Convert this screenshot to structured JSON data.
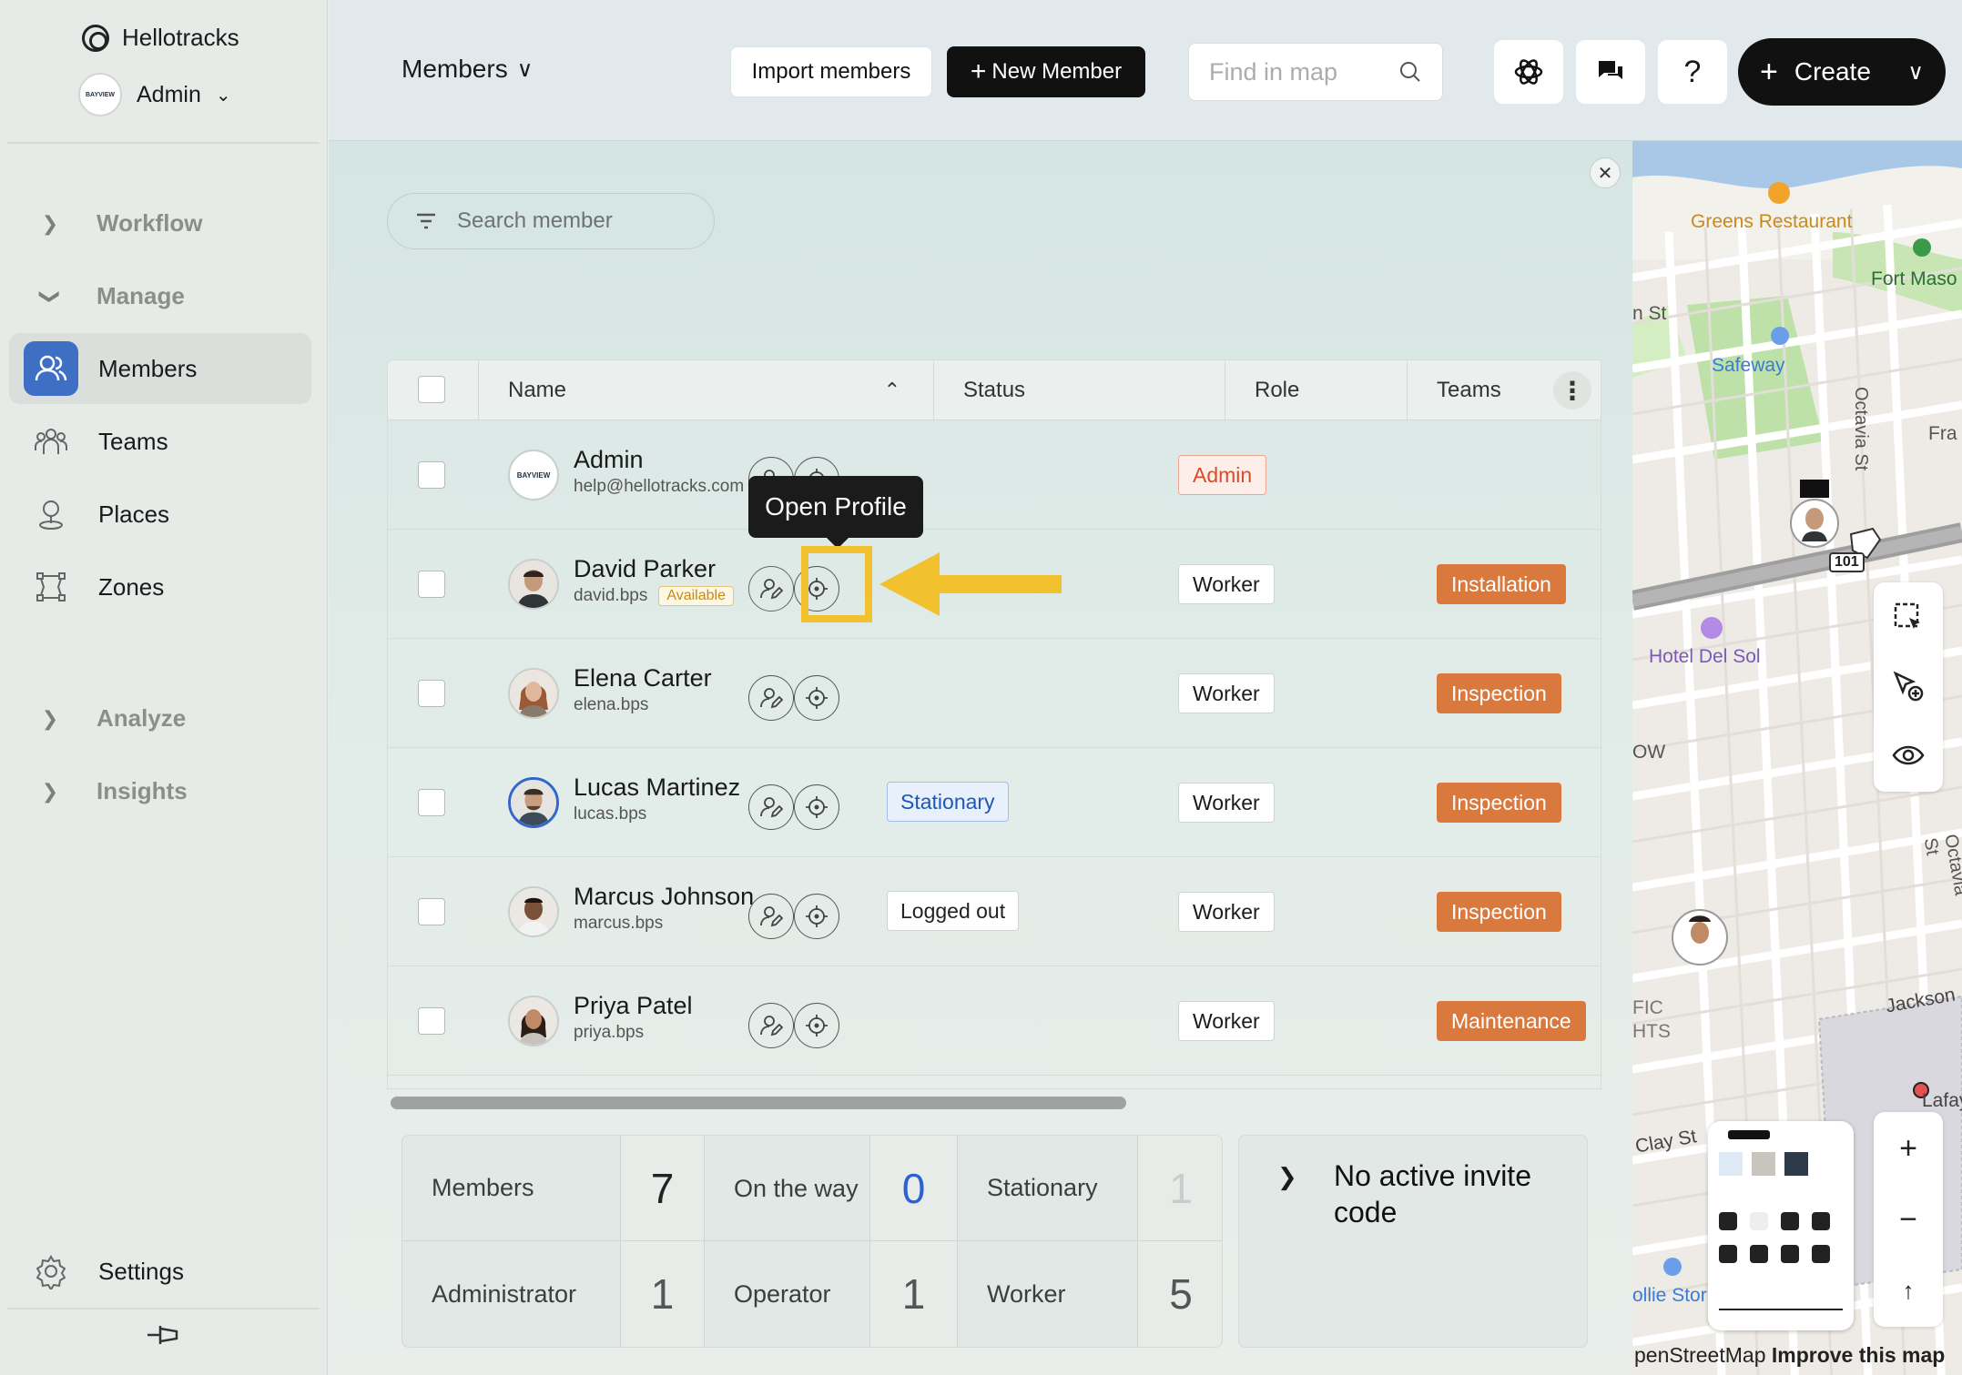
{
  "sidebar": {
    "brand": "Hellotracks",
    "account": {
      "name": "Admin",
      "logo_text": "BAYVIEW"
    },
    "groups": {
      "workflow": "Workflow",
      "manage": "Manage",
      "analyze": "Analyze",
      "insights": "Insights"
    },
    "items": [
      {
        "label": "Members",
        "active": true
      },
      {
        "label": "Teams"
      },
      {
        "label": "Places"
      },
      {
        "label": "Zones"
      }
    ],
    "settings": "Settings"
  },
  "topbar": {
    "page_title": "Members",
    "import_label": "Import members",
    "new_member_label": "New Member",
    "find_placeholder": "Find in map",
    "help_label": "?",
    "create_label": "Create"
  },
  "panel": {
    "search_placeholder": "Search member",
    "columns": {
      "name": "Name",
      "status": "Status",
      "role": "Role",
      "teams": "Teams"
    },
    "members": [
      {
        "name": "Admin",
        "sub": "help@hellotracks.com",
        "badge": "",
        "status": "",
        "role": "Admin",
        "team": ""
      },
      {
        "name": "David Parker",
        "sub": "david.bps",
        "badge": "Available",
        "status": "",
        "role": "Worker",
        "team": "Installation"
      },
      {
        "name": "Elena Carter",
        "sub": "elena.bps",
        "badge": "",
        "status": "",
        "role": "Worker",
        "team": "Inspection"
      },
      {
        "name": "Lucas Martinez",
        "sub": "lucas.bps",
        "badge": "",
        "status": "Stationary",
        "role": "Worker",
        "team": "Inspection"
      },
      {
        "name": "Marcus Johnson",
        "sub": "marcus.bps",
        "badge": "",
        "status": "Logged out",
        "role": "Worker",
        "team": "Inspection"
      },
      {
        "name": "Priya Patel",
        "sub": "priya.bps",
        "badge": "",
        "status": "",
        "role": "Worker",
        "team": "Maintenance"
      }
    ],
    "tooltip": "Open Profile",
    "stats": {
      "members_label": "Members",
      "members_value": "7",
      "ontheway_label": "On the way",
      "ontheway_value": "0",
      "stationary_label": "Stationary",
      "stationary_value": "1",
      "administrator_label": "Administrator",
      "administrator_value": "1",
      "operator_label": "Operator",
      "operator_value": "1",
      "worker_label": "Worker",
      "worker_value": "5"
    },
    "invite": "No active invite code"
  },
  "map": {
    "labels": {
      "greens": "Greens Restaurant",
      "fort": "Fort Maso",
      "safeway": "Safeway",
      "hotel": "Hotel Del Sol",
      "octavia1": "Octavia St",
      "octavia2": "Octavia St",
      "fra": "Fra",
      "st": "n St",
      "ow": "OW",
      "fic": "FIC\nHTS",
      "clay": "Clay St",
      "jackson": "Jackson",
      "lafay": "Lafaye",
      "ollie": "ollie Stor",
      "hwy": "101"
    },
    "attribution": "penStreetMap",
    "improve": "Improve this map"
  },
  "colors": {
    "accent_blue": "#3f6fc4",
    "team_orange": "#d9793e",
    "highlight_yellow": "#f2c12e"
  }
}
